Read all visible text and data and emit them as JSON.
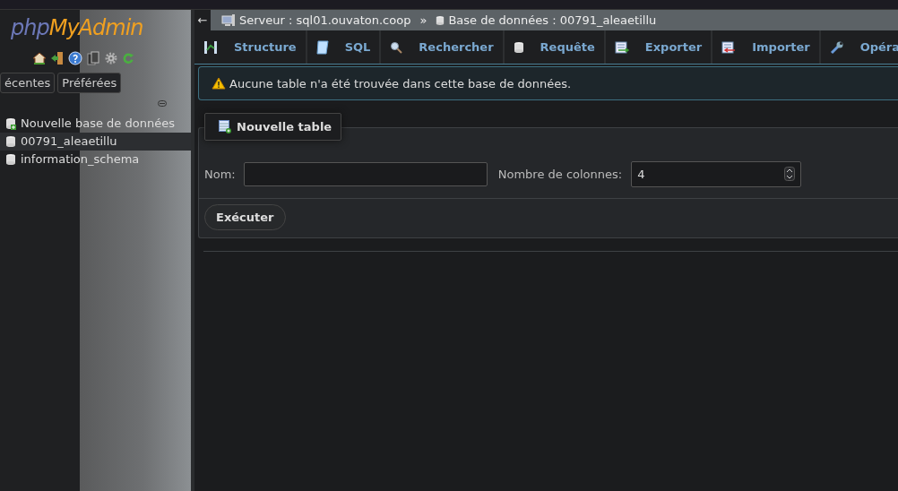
{
  "logo": {
    "part_1": "php",
    "part_2": "MyAdmin"
  },
  "sidebar": {
    "tabs": [
      {
        "label": "écentes",
        "selected": false
      },
      {
        "label": "Préférées",
        "selected": false
      }
    ],
    "databases": [
      {
        "name": "Nouvelle base de données",
        "kind": "new",
        "selected": false
      },
      {
        "name": "00791_aleaetillu",
        "kind": "db",
        "selected": true
      },
      {
        "name": "information_schema",
        "kind": "db",
        "selected": false
      }
    ]
  },
  "breadcrumb": {
    "back": "←",
    "server": "Serveur : sql01.ouvaton.coop",
    "separator": "»",
    "database": "Base de données : 00791_aleaetillu"
  },
  "tabs": [
    {
      "label": "Structure",
      "kind": "structure",
      "selected": false
    },
    {
      "label": "SQL",
      "kind": "sql",
      "selected": false
    },
    {
      "label": "Rechercher",
      "kind": "search",
      "selected": false
    },
    {
      "label": "Requête",
      "kind": "db",
      "selected": false
    },
    {
      "label": "Exporter",
      "kind": "export",
      "selected": false
    },
    {
      "label": "Importer",
      "kind": "import",
      "selected": false
    },
    {
      "label": "Opéra",
      "kind": "wrench",
      "selected": false
    }
  ],
  "alert": "Aucune table n'a été trouvée dans cette base de données.",
  "new_table": {
    "legend": "Nouvelle table",
    "name_label": "Nom:",
    "columns_label": "Nombre de colonnes:",
    "columns_value": "4",
    "submit": "Exécuter"
  }
}
